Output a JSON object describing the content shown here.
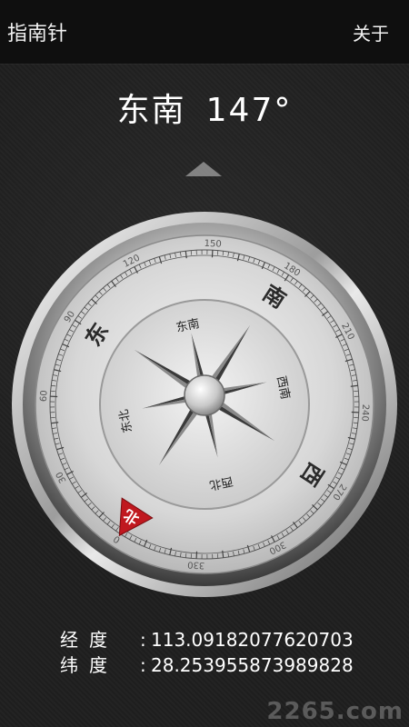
{
  "appbar": {
    "title": "指南针",
    "about_label": "关于"
  },
  "heading": {
    "direction": "东南",
    "degrees": "147°"
  },
  "compass": {
    "heading_degrees": 147,
    "big_labels": [
      "南",
      "西",
      "北",
      "东"
    ],
    "inner_labels": [
      "东南",
      "西南",
      "西北",
      "东北"
    ],
    "north_marker_text": "北",
    "tick_labels": [
      "0",
      "30",
      "60",
      "90",
      "120",
      "150",
      "180",
      "210",
      "240",
      "270",
      "300",
      "330"
    ],
    "marker_color": "#c0181f"
  },
  "coordinates": {
    "longitude_label": "经度",
    "longitude_value": "113.09182077620703",
    "latitude_label": "纬度",
    "latitude_value": "28.253955873989828"
  },
  "watermark": {
    "text": "2265.com"
  }
}
